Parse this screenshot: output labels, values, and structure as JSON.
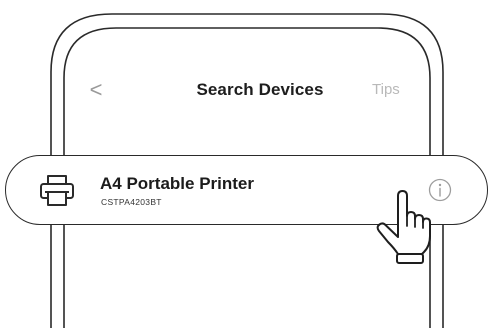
{
  "header": {
    "back_glyph": "<",
    "title": "Search Devices",
    "tips_label": "Tips"
  },
  "device": {
    "name": "A4 Portable Printer",
    "serial": "CSTPA4203BT",
    "icon": "printer-icon",
    "info_icon": "info-icon"
  },
  "gesture": {
    "icon": "tap-hand-icon"
  },
  "colors": {
    "line": "#2a2a2a",
    "muted": "#b9b9b9",
    "title": "#1e1e1e"
  }
}
